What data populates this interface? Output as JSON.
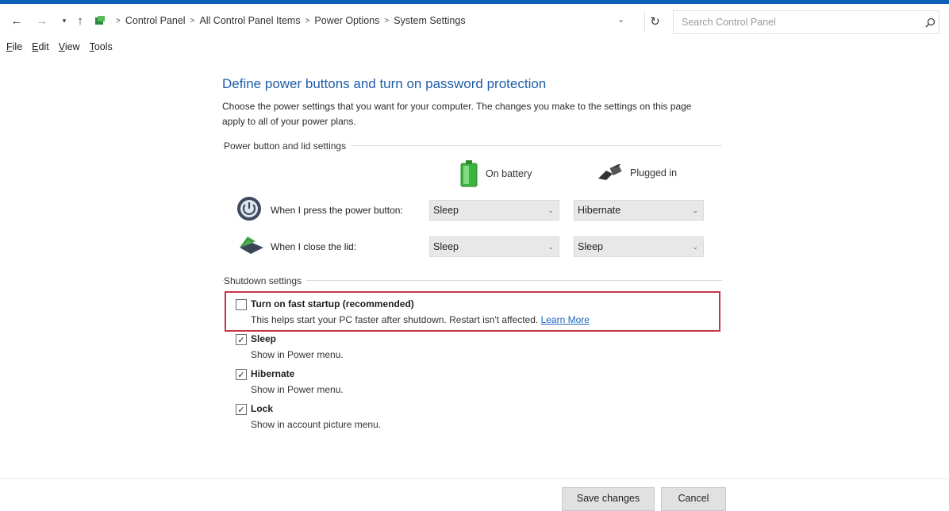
{
  "window": {
    "accent_color": "#0e5fb6"
  },
  "addressbar": {
    "breadcrumbs": [
      "Control Panel",
      "All Control Panel Items",
      "Power Options",
      "System Settings"
    ],
    "search_placeholder": "Search Control Panel",
    "icons": {
      "back": "back-arrow-icon",
      "forward": "forward-arrow-icon",
      "recent": "dropdown-icon",
      "up": "up-arrow-icon",
      "refresh": "refresh-icon",
      "search": "search-icon"
    }
  },
  "menubar": {
    "items": [
      "File",
      "Edit",
      "View",
      "Tools"
    ]
  },
  "page": {
    "title": "Define power buttons and turn on password protection",
    "description": "Choose the power settings that you want for your computer. The changes you make to the settings on this page apply to all of your power plans."
  },
  "power_buttons": {
    "group_label": "Power button and lid settings",
    "col_battery": "On battery",
    "col_plugged": "Plugged in",
    "rows": [
      {
        "label": "When I press the power button:",
        "battery": "Sleep",
        "plugged": "Hibernate"
      },
      {
        "label": "When I close the lid:",
        "battery": "Sleep",
        "plugged": "Sleep"
      }
    ]
  },
  "shutdown": {
    "group_label": "Shutdown settings",
    "options": [
      {
        "title": "Turn on fast startup (recommended)",
        "subtitle": "This helps start your PC faster after shutdown. Restart isn't affected.",
        "link": "Learn More",
        "checked": false
      },
      {
        "title": "Sleep",
        "subtitle": "Show in Power menu.",
        "checked": true
      },
      {
        "title": "Hibernate",
        "subtitle": "Show in Power menu.",
        "checked": true
      },
      {
        "title": "Lock",
        "subtitle": "Show in account picture menu.",
        "checked": true
      }
    ],
    "highlight_color": "#c8334a"
  },
  "footer": {
    "save_label": "Save changes",
    "cancel_label": "Cancel"
  }
}
